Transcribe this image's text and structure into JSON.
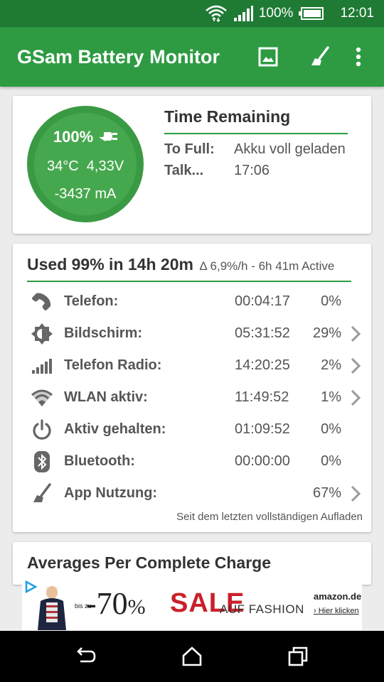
{
  "status_bar": {
    "battery_percent": "100%",
    "time": "12:01",
    "icons": [
      "wifi-icon",
      "signal-icon",
      "battery-charging-icon"
    ]
  },
  "app_bar": {
    "title": "GSam Battery Monitor",
    "actions": [
      "image-icon",
      "broom-icon",
      "overflow-menu-icon"
    ]
  },
  "battery_card": {
    "percent": "100%",
    "temperature": "34°C",
    "voltage": "4,33V",
    "current": "-3437 mA",
    "plug_icon": "plug-icon",
    "time_remaining": {
      "title": "Time Remaining",
      "rows": [
        {
          "label": "To Full:",
          "value": "Akku voll geladen"
        },
        {
          "label": "Talk...",
          "value": "17:06"
        }
      ]
    }
  },
  "usage_card": {
    "headline": "Used 99% in 14h 20m",
    "subline": "Δ 6,9%/h - 6h 41m Active",
    "rows": [
      {
        "icon": "phone-icon",
        "label": "Telefon:",
        "time": "00:04:17",
        "percent": "0%",
        "has_chevron": false
      },
      {
        "icon": "brightness-icon",
        "label": "Bildschirm:",
        "time": "05:31:52",
        "percent": "29%",
        "has_chevron": true
      },
      {
        "icon": "cell-signal-icon",
        "label": "Telefon Radio:",
        "time": "14:20:25",
        "percent": "2%",
        "has_chevron": true
      },
      {
        "icon": "wifi-icon",
        "label": "WLAN aktiv:",
        "time": "11:49:52",
        "percent": "1%",
        "has_chevron": true
      },
      {
        "icon": "power-icon",
        "label": "Aktiv gehalten:",
        "time": "01:09:52",
        "percent": "0%",
        "has_chevron": false
      },
      {
        "icon": "bluetooth-icon",
        "label": "Bluetooth:",
        "time": "00:00:00",
        "percent": "0%",
        "has_chevron": false
      },
      {
        "icon": "broom-icon",
        "label": "App Nutzung:",
        "time": "",
        "percent": "67%",
        "has_chevron": true
      }
    ],
    "footer": "Seit dem letzten vollständigen Aufladen"
  },
  "averages_card": {
    "title": "Averages Per Complete Charge"
  },
  "ad_banner": {
    "prefix": "bis zu",
    "discount_number": "-70",
    "discount_sign": "%",
    "sale": "SALE",
    "tagline": "AUF FASHION",
    "brand": "amazon.de",
    "cta": "› Hier klicken"
  },
  "nav_bar": {
    "buttons": [
      "back-icon",
      "home-icon",
      "recents-icon"
    ]
  },
  "colors": {
    "status_bar": "#1f7a33",
    "app_bar": "#2e9b42",
    "gauge_ring": "#3a9a44",
    "gauge_fill": "#46a84e",
    "sale_red": "#c9202a"
  }
}
